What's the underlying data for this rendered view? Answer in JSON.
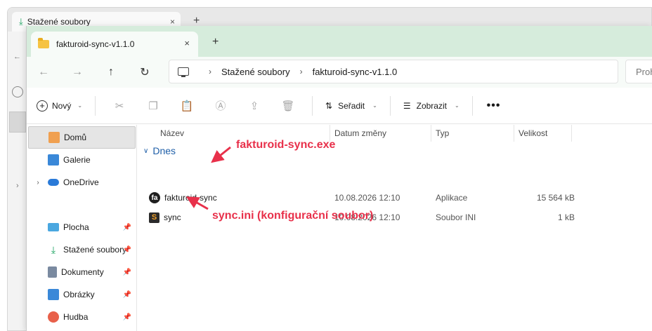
{
  "background_window": {
    "tab_title": "Stažené soubory",
    "tab_close": "×",
    "new_tab": "+"
  },
  "window": {
    "tab_title": "fakturoid-sync-v1.1.0",
    "tab_close": "×",
    "new_tab": "+"
  },
  "nav": {
    "back": "←",
    "forward": "→",
    "up": "↑",
    "refresh": "↻",
    "breadcrumbs": [
      "Stažené soubory",
      "fakturoid-sync-v1.1.0"
    ],
    "separator": "›",
    "search_placeholder": "Proh"
  },
  "toolbar": {
    "new_label": "Nový",
    "sort_label": "Seřadit",
    "view_label": "Zobrazit",
    "more": "•••",
    "icons": [
      "cut-icon",
      "copy-icon",
      "paste-icon",
      "rename-icon",
      "share-icon",
      "delete-icon"
    ]
  },
  "sidebar": {
    "items": [
      {
        "label": "Domů",
        "icon": "home-icon",
        "color": "#f0a050",
        "selected": true,
        "pinned": false
      },
      {
        "label": "Galerie",
        "icon": "gallery-icon",
        "color": "#3a88d8",
        "selected": false,
        "pinned": false
      },
      {
        "label": "OneDrive",
        "icon": "onedrive-icon",
        "color": "#2a7ad8",
        "selected": false,
        "pinned": false
      },
      {
        "label": "Plocha",
        "icon": "desktop-icon",
        "color": "#4aa7e0",
        "selected": false,
        "pinned": true
      },
      {
        "label": "Stažené soubory",
        "icon": "download-icon",
        "color": "#1aa35f",
        "selected": false,
        "pinned": true
      },
      {
        "label": "Dokumenty",
        "icon": "documents-icon",
        "color": "#7a8aa0",
        "selected": false,
        "pinned": true
      },
      {
        "label": "Obrázky",
        "icon": "pictures-icon",
        "color": "#3a88d8",
        "selected": false,
        "pinned": true
      },
      {
        "label": "Hudba",
        "icon": "music-icon",
        "color": "#e8604a",
        "selected": false,
        "pinned": true
      }
    ]
  },
  "columns": {
    "name": "Název",
    "date": "Datum změny",
    "type": "Typ",
    "size": "Velikost"
  },
  "group": {
    "label": "Dnes",
    "chevron": "∨"
  },
  "files": [
    {
      "name": "fakturoid-sync",
      "icon": "fakturoid-app-icon",
      "icon_text": "fa",
      "date": "10.08.2026 12:10",
      "type": "Aplikace",
      "size": "15 564 kB"
    },
    {
      "name": "sync",
      "icon": "ini-file-icon",
      "icon_text": "S",
      "date": "10.08.2026 12:10",
      "type": "Soubor INI",
      "size": "1 kB"
    }
  ],
  "annotations": {
    "exe": "fakturoid-sync.exe",
    "ini": "sync.ini (konfigurační soubor)",
    "color": "#e8304a"
  }
}
